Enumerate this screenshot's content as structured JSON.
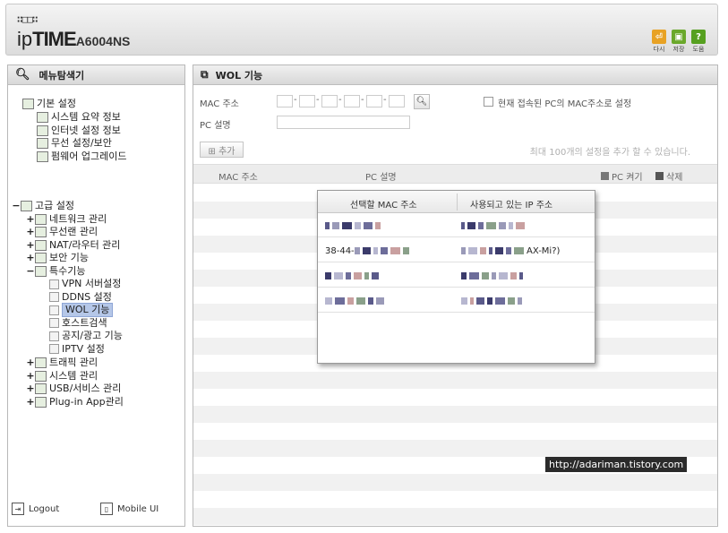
{
  "header": {
    "logo_dots": "∷□□∷",
    "brand_ip": "ip",
    "brand_time": "TIME",
    "brand_model": "A6004NS",
    "icons": [
      {
        "name": "logout-icon",
        "label": "다시",
        "color": "#e8a224",
        "glyph": "⏎"
      },
      {
        "name": "save-icon",
        "label": "저장",
        "color": "#6aa82a",
        "glyph": "▣"
      },
      {
        "name": "help-icon",
        "label": "도움",
        "color": "#56a020",
        "glyph": "?"
      }
    ]
  },
  "sidebar": {
    "title": "메뉴탐색기",
    "basic": {
      "label": "기본 설정",
      "items": [
        "시스템 요약 정보",
        "인터넷 설정 정보",
        "무선 설정/보안",
        "펌웨어 업그레이드"
      ]
    },
    "advanced": {
      "toggle": "−",
      "label": "고급 설정",
      "groups_before": [
        {
          "toggle": "+",
          "label": "네트워크 관리"
        },
        {
          "toggle": "+",
          "label": "무선랜 관리"
        },
        {
          "toggle": "+",
          "label": "NAT/라우터 관리"
        },
        {
          "toggle": "+",
          "label": "보안 기능"
        }
      ],
      "special": {
        "toggle": "−",
        "label": "특수기능",
        "items": [
          "VPN 서버설정",
          "DDNS 설정",
          "WOL 기능",
          "호스트검색",
          "공지/광고 기능",
          "IPTV 설정"
        ],
        "selected_index": 2
      },
      "groups_after": [
        {
          "toggle": "+",
          "label": "트래픽 관리"
        },
        {
          "toggle": "+",
          "label": "시스템 관리"
        },
        {
          "toggle": "+",
          "label": "USB/서비스 관리"
        },
        {
          "toggle": "+",
          "label": "Plug-in App관리"
        }
      ]
    },
    "bottom": {
      "logout": "Logout",
      "mobile": "Mobile UI"
    }
  },
  "main": {
    "title": "WOL 기능",
    "mac_label": "MAC 주소",
    "pc_desc_label": "PC 설명",
    "current_pc_label": "현재 접속된 PC의 MAC주소로 설정",
    "add_button": "⊞ 추가",
    "max_note": "최대 100개의 설정을 추가 할 수 있습니다.",
    "table": {
      "col_mac": "MAC 주소",
      "col_pc": "PC 설명",
      "col_wake": "PC 켜기",
      "col_delete": "삭제"
    }
  },
  "popup": {
    "col_mac": "선택할 MAC 주소",
    "col_host": "사용되고 있는 IP 주소",
    "rows": [
      {
        "mac": "",
        "host": ""
      },
      {
        "mac": "38-44-",
        "host": "AX-Mi?)"
      },
      {
        "mac": "",
        "host": ""
      },
      {
        "mac": "",
        "host": ""
      }
    ]
  },
  "watermark": "http://adariman.tistory.com"
}
